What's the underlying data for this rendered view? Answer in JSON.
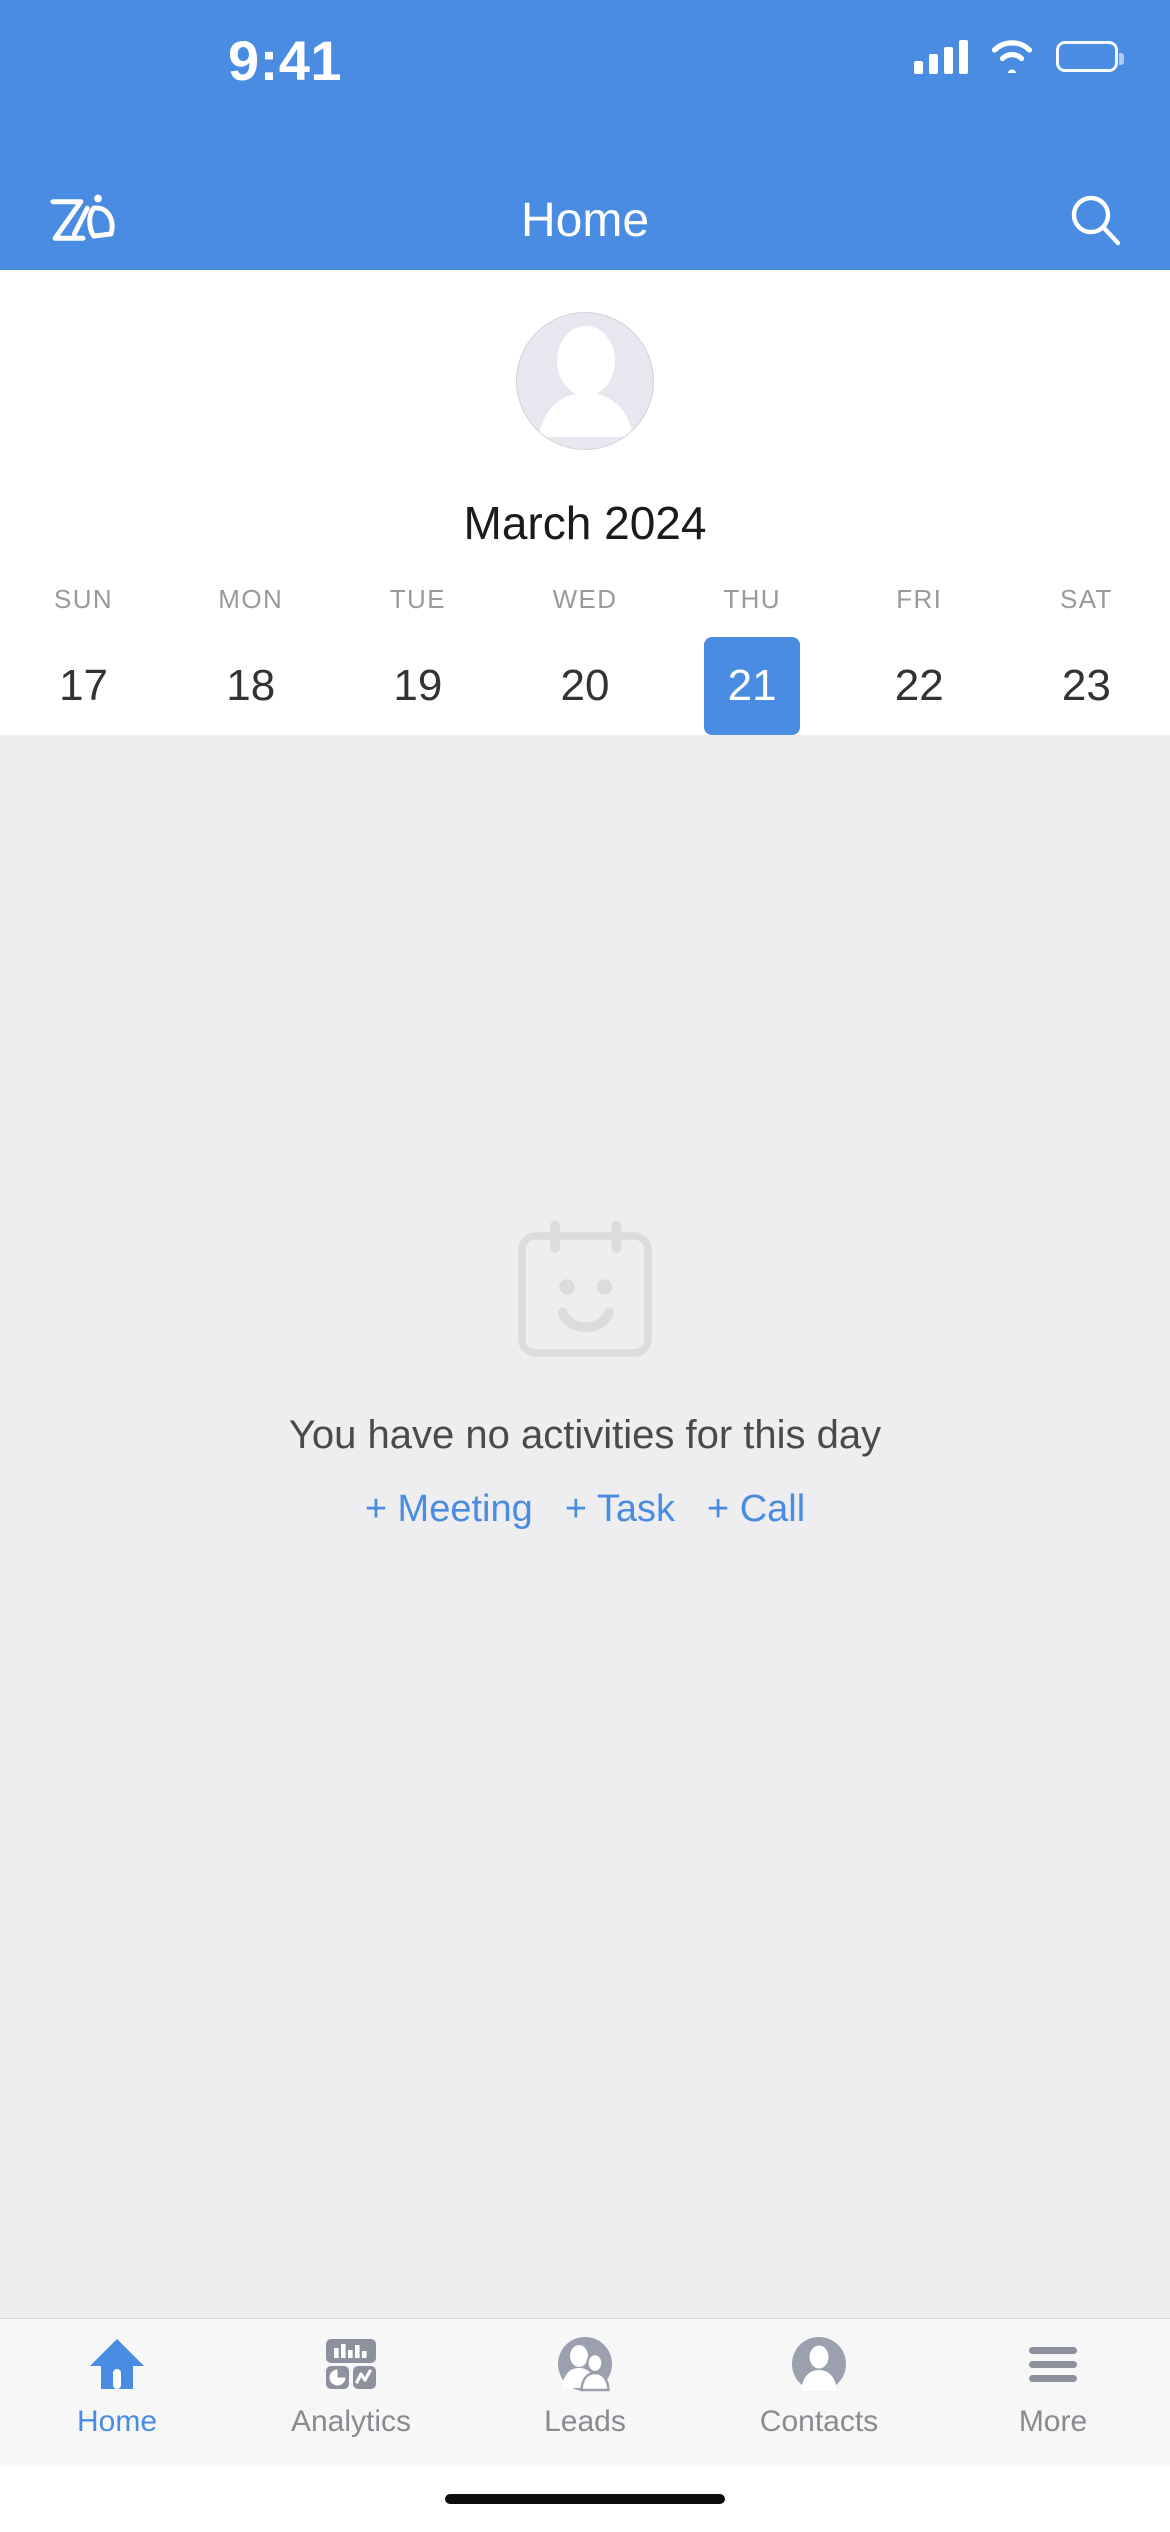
{
  "status_bar": {
    "time": "9:41",
    "signal_icon": "cellular-signal-icon",
    "wifi_icon": "wifi-icon",
    "battery_icon": "battery-icon"
  },
  "nav_bar": {
    "logo_name": "zia-logo",
    "title": "Home",
    "search_icon": "search-icon"
  },
  "profile": {
    "avatar_name": "user-avatar-placeholder"
  },
  "calendar": {
    "month_label": "March 2024",
    "weekdays": [
      "SUN",
      "MON",
      "TUE",
      "WED",
      "THU",
      "FRI",
      "SAT"
    ],
    "days": [
      {
        "num": "17",
        "dow": "SUN",
        "selected": false,
        "has_event": false
      },
      {
        "num": "18",
        "dow": "MON",
        "selected": false,
        "has_event": false
      },
      {
        "num": "19",
        "dow": "TUE",
        "selected": false,
        "has_event": false
      },
      {
        "num": "20",
        "dow": "WED",
        "selected": false,
        "has_event": true
      },
      {
        "num": "21",
        "dow": "THU",
        "selected": true,
        "has_event": false
      },
      {
        "num": "22",
        "dow": "FRI",
        "selected": false,
        "has_event": false
      },
      {
        "num": "23",
        "dow": "SAT",
        "selected": false,
        "has_event": false
      }
    ],
    "selected_day": "21",
    "selected_color": "#4a8ce2",
    "event_dot_color": "#9b9b9b"
  },
  "empty_state": {
    "illustration_name": "calendar-smiley-icon",
    "message": "You have no activities for this day",
    "actions": [
      {
        "label": "+ Meeting",
        "name": "add-meeting-link"
      },
      {
        "label": "+ Task",
        "name": "add-task-link"
      },
      {
        "label": "+ Call",
        "name": "add-call-link"
      }
    ]
  },
  "tab_bar": {
    "active": "Home",
    "tabs": [
      {
        "label": "Home",
        "icon": "home-icon",
        "active": true
      },
      {
        "label": "Analytics",
        "icon": "analytics-icon",
        "active": false
      },
      {
        "label": "Leads",
        "icon": "leads-icon",
        "active": false
      },
      {
        "label": "Contacts",
        "icon": "contacts-icon",
        "active": false
      },
      {
        "label": "More",
        "icon": "hamburger-icon",
        "active": false
      }
    ]
  },
  "theme": {
    "accent": "#4a8ce2",
    "body_background": "#eeeef0",
    "tabbar_background": "#f7f7f8",
    "muted_text": "#8a8a90"
  }
}
